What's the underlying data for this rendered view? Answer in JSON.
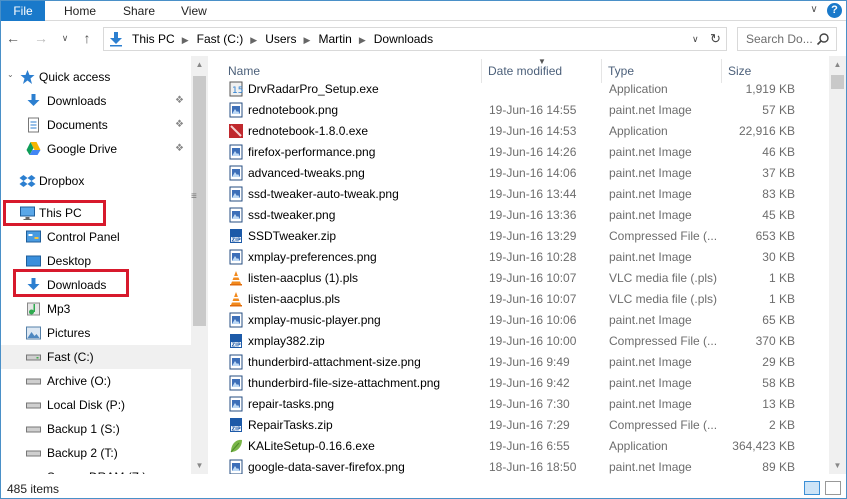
{
  "ribbon": {
    "file_label": "File",
    "tabs": [
      "Home",
      "Share",
      "View"
    ],
    "help_label": "?"
  },
  "address": {
    "crumbs": [
      "This PC",
      "Fast (C:)",
      "Users",
      "Martin",
      "Downloads"
    ],
    "search_placeholder": "Search Do..."
  },
  "nav": {
    "quick_access": "Quick access",
    "quick_items": [
      {
        "label": "Downloads",
        "icon": "download-arrow-icon"
      },
      {
        "label": "Documents",
        "icon": "documents-icon"
      },
      {
        "label": "Google Drive",
        "icon": "google-drive-icon"
      }
    ],
    "dropbox": "Dropbox",
    "this_pc": "This PC",
    "pc_items": [
      {
        "label": "Control Panel",
        "icon": "control-panel-icon"
      },
      {
        "label": "Desktop",
        "icon": "desktop-icon"
      },
      {
        "label": "Downloads",
        "icon": "download-arrow-icon"
      },
      {
        "label": "Mp3",
        "icon": "music-icon"
      },
      {
        "label": "Pictures",
        "icon": "pictures-icon"
      },
      {
        "label": "Fast (C:)",
        "icon": "drive-icon"
      },
      {
        "label": "Archive (O:)",
        "icon": "drive-icon"
      },
      {
        "label": "Local Disk (P:)",
        "icon": "drive-icon"
      },
      {
        "label": "Backup 1 (S:)",
        "icon": "drive-icon"
      },
      {
        "label": "Backup 2 (T:)",
        "icon": "drive-icon"
      },
      {
        "label": "Secure-DRAM (Z:)",
        "icon": "drive-icon"
      }
    ]
  },
  "columns": {
    "name": "Name",
    "date": "Date modified",
    "type": "Type",
    "size": "Size"
  },
  "files": [
    {
      "name": "DrvRadarPro_Setup.exe",
      "date": "",
      "type": "Application",
      "size": "1,919 KB",
      "icon": "installer-icon"
    },
    {
      "name": "rednotebook.png",
      "date": "19-Jun-16 14:55",
      "type": "paint.net Image",
      "size": "57 KB",
      "icon": "image-file-icon"
    },
    {
      "name": "rednotebook-1.8.0.exe",
      "date": "19-Jun-16 14:53",
      "type": "Application",
      "size": "22,916 KB",
      "icon": "app-red-icon"
    },
    {
      "name": "firefox-performance.png",
      "date": "19-Jun-16 14:26",
      "type": "paint.net Image",
      "size": "46 KB",
      "icon": "image-file-icon"
    },
    {
      "name": "advanced-tweaks.png",
      "date": "19-Jun-16 14:06",
      "type": "paint.net Image",
      "size": "37 KB",
      "icon": "image-file-icon"
    },
    {
      "name": "ssd-tweaker-auto-tweak.png",
      "date": "19-Jun-16 13:44",
      "type": "paint.net Image",
      "size": "83 KB",
      "icon": "image-file-icon"
    },
    {
      "name": "ssd-tweaker.png",
      "date": "19-Jun-16 13:36",
      "type": "paint.net Image",
      "size": "45 KB",
      "icon": "image-file-icon"
    },
    {
      "name": "SSDTweaker.zip",
      "date": "19-Jun-16 13:29",
      "type": "Compressed File (...",
      "size": "653 KB",
      "icon": "zip-icon"
    },
    {
      "name": "xmplay-preferences.png",
      "date": "19-Jun-16 10:28",
      "type": "paint.net Image",
      "size": "30 KB",
      "icon": "image-file-icon"
    },
    {
      "name": "listen-aacplus (1).pls",
      "date": "19-Jun-16 10:07",
      "type": "VLC media file (.pls)",
      "size": "1 KB",
      "icon": "vlc-cone-icon"
    },
    {
      "name": "listen-aacplus.pls",
      "date": "19-Jun-16 10:07",
      "type": "VLC media file (.pls)",
      "size": "1 KB",
      "icon": "vlc-cone-icon"
    },
    {
      "name": "xmplay-music-player.png",
      "date": "19-Jun-16 10:06",
      "type": "paint.net Image",
      "size": "65 KB",
      "icon": "image-file-icon"
    },
    {
      "name": "xmplay382.zip",
      "date": "19-Jun-16 10:00",
      "type": "Compressed File (...",
      "size": "370 KB",
      "icon": "zip-icon"
    },
    {
      "name": "thunderbird-attachment-size.png",
      "date": "19-Jun-16 9:49",
      "type": "paint.net Image",
      "size": "29 KB",
      "icon": "image-file-icon"
    },
    {
      "name": "thunderbird-file-size-attachment.png",
      "date": "19-Jun-16 9:42",
      "type": "paint.net Image",
      "size": "58 KB",
      "icon": "image-file-icon"
    },
    {
      "name": "repair-tasks.png",
      "date": "19-Jun-16 7:30",
      "type": "paint.net Image",
      "size": "13 KB",
      "icon": "image-file-icon"
    },
    {
      "name": "RepairTasks.zip",
      "date": "19-Jun-16 7:29",
      "type": "Compressed File (...",
      "size": "2 KB",
      "icon": "zip-icon"
    },
    {
      "name": "KALiteSetup-0.16.6.exe",
      "date": "19-Jun-16 6:55",
      "type": "Application",
      "size": "364,423 KB",
      "icon": "leaf-app-icon"
    },
    {
      "name": "google-data-saver-firefox.png",
      "date": "18-Jun-16 18:50",
      "type": "paint.net Image",
      "size": "89 KB",
      "icon": "image-file-icon"
    }
  ],
  "status": {
    "item_count": "485 items"
  },
  "colors": {
    "accent": "#1979ca",
    "highlight_box": "#d7192c",
    "selection": "#e5f0fb"
  }
}
